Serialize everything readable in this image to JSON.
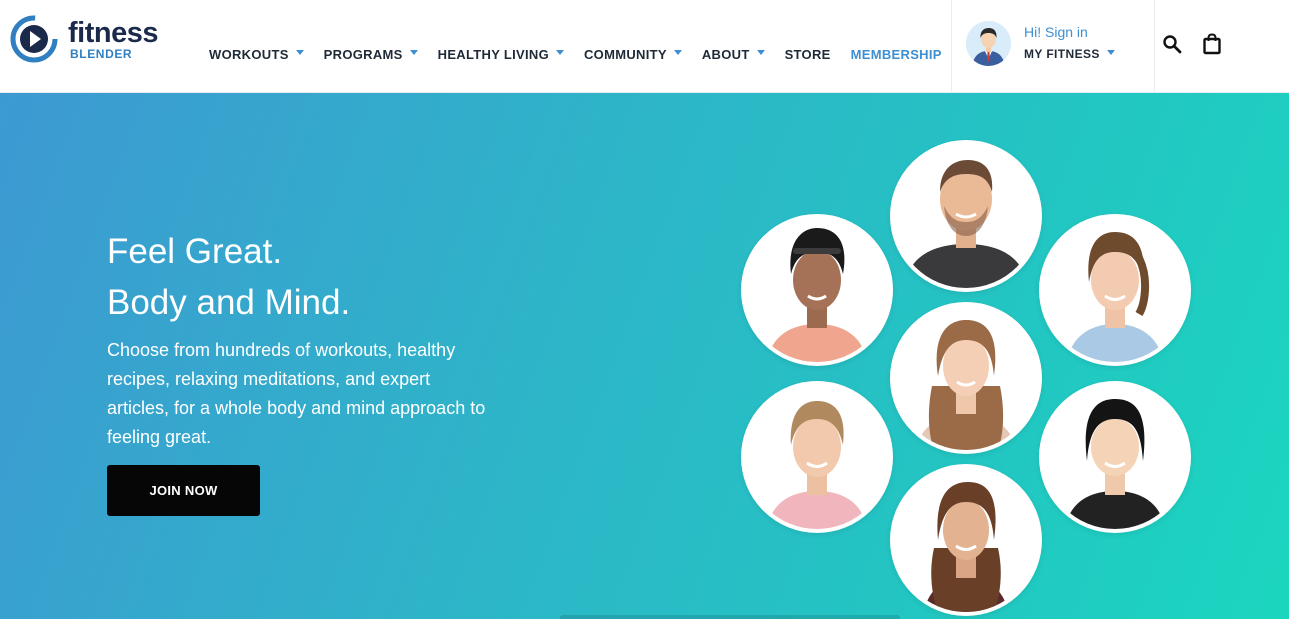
{
  "brand": {
    "name": "fitness",
    "sub": "BLENDER",
    "colors": {
      "navy": "#1b2a4a",
      "blue": "#2f7fc1",
      "accent": "#3d8fd1"
    }
  },
  "nav": {
    "items": [
      {
        "label": "WORKOUTS",
        "has_dropdown": true
      },
      {
        "label": "PROGRAMS",
        "has_dropdown": true
      },
      {
        "label": "HEALTHY LIVING",
        "has_dropdown": true
      },
      {
        "label": "COMMUNITY",
        "has_dropdown": true
      },
      {
        "label": "ABOUT",
        "has_dropdown": true
      },
      {
        "label": "STORE",
        "has_dropdown": false
      },
      {
        "label": "MEMBERSHIP",
        "has_dropdown": false,
        "highlight": true
      }
    ]
  },
  "account": {
    "greeting": "Hi! Sign in",
    "menu_label": "MY FITNESS",
    "avatar_icon": "user-avatar"
  },
  "tools": {
    "search_icon": "search-icon",
    "cart_icon": "shopping-bag-icon"
  },
  "hero": {
    "headline_line1": "Feel Great.",
    "headline_line2": "Body and Mind.",
    "description": "Choose from hundreds of workouts, healthy recipes, relaxing meditations, and expert articles, for a whole body and mind approach to feeling great.",
    "cta_label": "JOIN NOW",
    "gradient": {
      "start": "#3d99d2",
      "end": "#1bd6bf"
    },
    "trainer_photos_count": 7
  }
}
